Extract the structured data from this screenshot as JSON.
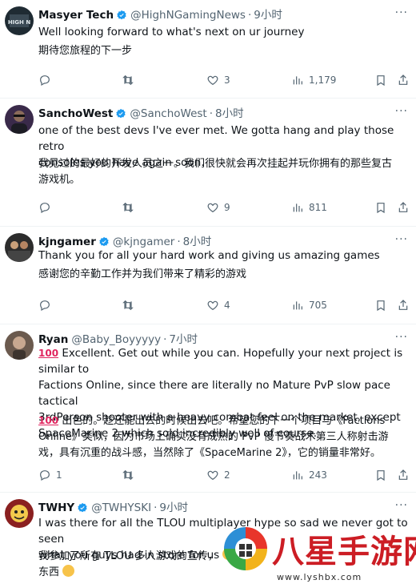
{
  "tweets": [
    {
      "name": "Masyer Tech",
      "verified": true,
      "handle": "@HighNGamingNews",
      "time": "9小时",
      "text_lines": [
        "Well looking forward to what's next on ur journey"
      ],
      "translation_lines": [
        "期待您旅程的下一步"
      ],
      "replies": "",
      "retweets": "",
      "likes": "3",
      "views": "1,179",
      "avatar_color": "#1f2b33"
    },
    {
      "name": "SanchoWest",
      "verified": true,
      "handle": "@SanchoWest",
      "time": "8小时",
      "text_lines": [
        "one of the best devs I've ever met. We gotta hang and play those retro",
        "consoles you have again soon."
      ],
      "translation_lines": [
        "我见过的最好的开发人员之一。我们很快就会再次挂起并玩你拥有的那些复古",
        "游戏机。"
      ],
      "replies": "",
      "retweets": "",
      "likes": "9",
      "views": "811",
      "avatar_color": "#3a2a4a"
    },
    {
      "name": "kjngamer",
      "verified": true,
      "handle": "@kjngamer",
      "time": "8小时",
      "text_lines": [
        "Thank you for all your hard work and giving us amazing games"
      ],
      "translation_lines": [
        "感谢您的辛勤工作并为我们带来了精彩的游戏"
      ],
      "replies": "",
      "retweets": "",
      "likes": "4",
      "views": "705",
      "avatar_color": "#2c2c2c"
    },
    {
      "name": "Ryan",
      "verified": false,
      "handle": "@Baby_Boyyyyy",
      "time": "7小时",
      "text_lines": [
        "Excellent. Get out while you can. Hopefully your next project is similar to",
        "Factions Online, since there are literally no Mature PvP slow pace tactical",
        "3rdPerson shooter with a heavy combat feel on the market, except",
        "SpaceMarine 2 which sold incredibly well of course."
      ],
      "translation_lines": [
        "出色的。趁还能出去的时候出去吧。希望您的下一个项目与《Factions",
        "Online》类似，因为市场上确实没有成熟的 PvP 慢节奏战术第三人称射击游",
        "戏，具有沉重的战斗感，当然除了《SpaceMarine 2》，它的销量非常好。"
      ],
      "hundred": "100",
      "replies": "1",
      "retweets": "",
      "likes": "2",
      "views": "243",
      "avatar_color": "#6b5a4e"
    },
    {
      "name": "TWHY",
      "verified": true,
      "handle": "@TWHYSKI",
      "time": "9小时",
      "text_lines": [
        "I was there for all the TLOU multiplayer hype so sad we never got to seen",
        "what you guys had in store for us"
      ],
      "translation_lines": [
        "我参加了所有 TLOU 多人游戏的宣传，",
        "东西"
      ],
      "avatar_color": "#8a2020"
    }
  ],
  "watermark": {
    "title": "八星手游网",
    "url": "www.lyshbx.com"
  },
  "colors": {
    "verified": "#1d9bf0",
    "muted": "#536471",
    "divider": "#eff3f4",
    "watermark": "#cc1d24"
  }
}
